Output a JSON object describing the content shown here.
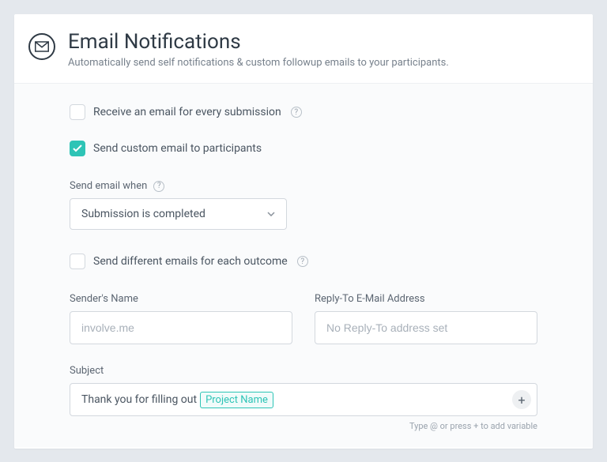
{
  "header": {
    "title": "Email Notifications",
    "subtitle": "Automatically send self notifications & custom followup emails to your participants."
  },
  "options": {
    "receive_every": {
      "label": "Receive an email for every submission",
      "checked": false
    },
    "send_custom": {
      "label": "Send custom email to participants",
      "checked": true
    },
    "different_outcome": {
      "label": "Send different emails for each outcome",
      "checked": false
    }
  },
  "trigger": {
    "label": "Send email when",
    "value": "Submission is completed"
  },
  "sender": {
    "name_label": "Sender's Name",
    "name_placeholder": "involve.me",
    "reply_label": "Reply-To E-Mail Address",
    "reply_placeholder": "No Reply-To address set"
  },
  "subject": {
    "label": "Subject",
    "prefix": "Thank you for filling out ",
    "variable": "Project Name",
    "add_hint": "Type @ or press + to add variable"
  },
  "glyphs": {
    "plus": "+"
  }
}
